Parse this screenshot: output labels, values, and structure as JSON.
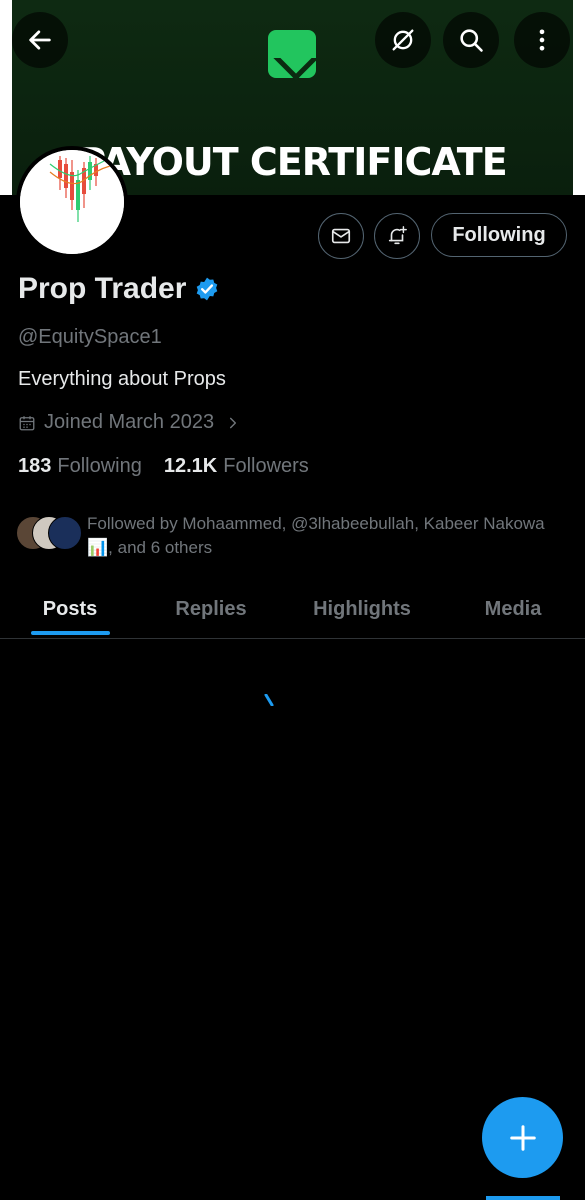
{
  "banner": {
    "text": "PAYOUT CERTIFICATE"
  },
  "header": {
    "back_icon": "arrow-left-icon",
    "grok_icon": "slashed-circle-icon",
    "search_icon": "search-icon",
    "more_icon": "more-vertical-icon"
  },
  "profile": {
    "name": "Prop Trader",
    "handle": "@EquitySpace1",
    "bio": "Everything about Props",
    "joined": "Joined March 2023",
    "following_count": "183",
    "following_label": "Following",
    "followers_count": "12.1K",
    "followers_label": "Followers",
    "followed_by": "Followed by Mohaammed, @3lhabeebullah, Kabeer Nakowa📊, and 6 others"
  },
  "actions": {
    "message_icon": "mail-icon",
    "notify_icon": "bell-plus-icon",
    "follow_label": "Following"
  },
  "tabs": [
    "Posts",
    "Replies",
    "Highlights",
    "Media"
  ],
  "colors": {
    "accent": "#1d9bf0",
    "verified": "#1d9bf0",
    "muted": "#71767b",
    "text": "#e7e9ea"
  }
}
